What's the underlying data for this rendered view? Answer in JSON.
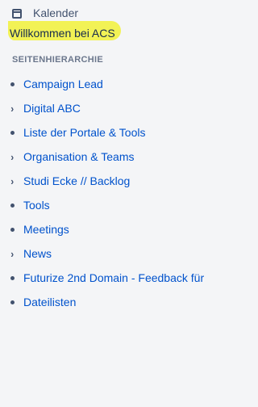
{
  "sidebar": {
    "calendar": {
      "label": "Kalender",
      "icon": "calendar-icon"
    },
    "welcome": {
      "label": "Willkommen bei ACS",
      "highlight_color": "#f2f255"
    },
    "section_title": "SEITENHIERARCHIE",
    "items": [
      {
        "label": "Campaign Lead",
        "marker": "bullet"
      },
      {
        "label": "Digital ABC",
        "marker": "chevron"
      },
      {
        "label": "Liste der Portale & Tools",
        "marker": "bullet"
      },
      {
        "label": "Organisation & Teams",
        "marker": "chevron"
      },
      {
        "label": "Studi Ecke // Backlog",
        "marker": "chevron"
      },
      {
        "label": "Tools",
        "marker": "bullet"
      },
      {
        "label": "Meetings",
        "marker": "bullet"
      },
      {
        "label": "News",
        "marker": "chevron"
      },
      {
        "label": "Futurize 2nd Domain - Feedback für",
        "marker": "bullet"
      },
      {
        "label": "Dateilisten",
        "marker": "bullet"
      }
    ]
  },
  "colors": {
    "link": "#0052cc",
    "text": "#42526e",
    "background": "#f4f5f7"
  }
}
